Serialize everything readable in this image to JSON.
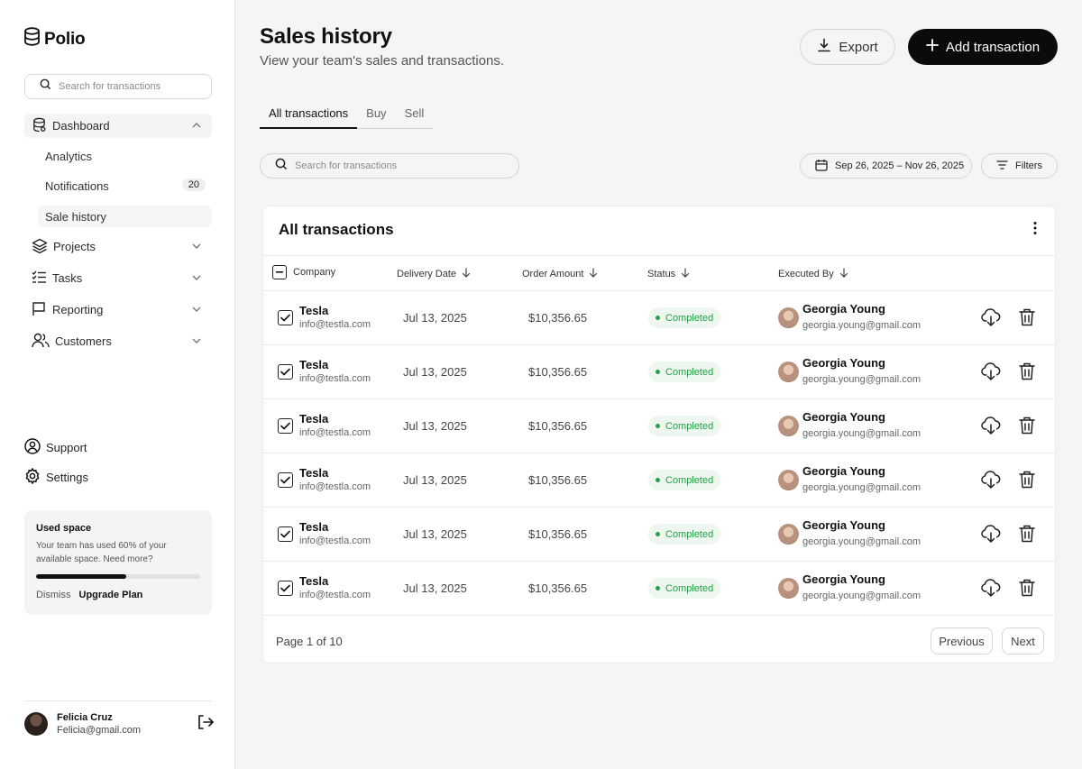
{
  "brand": {
    "name": "Polio"
  },
  "sidebar": {
    "search_placeholder": "Search for transactions",
    "nav": [
      {
        "label": "Dashboard",
        "icon": "database-icon"
      },
      {
        "label": "Projects",
        "icon": "layers-icon"
      },
      {
        "label": "Tasks",
        "icon": "list-checks-icon"
      },
      {
        "label": "Reporting",
        "icon": "flag-icon"
      },
      {
        "label": "Customers",
        "icon": "users-icon"
      }
    ],
    "sub": [
      {
        "label": "Analytics"
      },
      {
        "label": "Notifications",
        "badge": "20"
      },
      {
        "label": "Sale history"
      }
    ],
    "support": "Support",
    "settings": "Settings",
    "usage": {
      "title": "Used space",
      "text": "Your team has used 60% of your available space. Need more?",
      "percent": 0.55,
      "dismiss": "Dismiss",
      "upgrade": "Upgrade Plan"
    },
    "user": {
      "name": "Felicia Cruz",
      "email": "Felicia@gmail.com"
    }
  },
  "header": {
    "title": "Sales history",
    "subtitle": "View your team's sales and transactions.",
    "export_label": "Export",
    "add_label": "Add transaction"
  },
  "tabs": [
    "All transactions",
    "Buy",
    "Sell"
  ],
  "toolbar": {
    "search_placeholder": "Search for transactions",
    "date_range": "Sep 26, 2025 – Nov 26, 2025",
    "filters_label": "Filters"
  },
  "table": {
    "title": "All transactions",
    "columns": [
      "Company",
      "Delivery Date",
      "Order Amount",
      "Status",
      "Executed By"
    ],
    "rows": [
      {
        "company": "Tesla",
        "company_email": "info@testla.com",
        "date": "Jul 13, 2025",
        "amount": "$10,356.65",
        "status": "Completed",
        "executor": "Georgia Young",
        "executor_email": "georgia.young@gmail.com"
      },
      {
        "company": "Tesla",
        "company_email": "info@testla.com",
        "date": "Jul 13, 2025",
        "amount": "$10,356.65",
        "status": "Completed",
        "executor": "Georgia Young",
        "executor_email": "georgia.young@gmail.com"
      },
      {
        "company": "Tesla",
        "company_email": "info@testla.com",
        "date": "Jul 13, 2025",
        "amount": "$10,356.65",
        "status": "Completed",
        "executor": "Georgia Young",
        "executor_email": "georgia.young@gmail.com"
      },
      {
        "company": "Tesla",
        "company_email": "info@testla.com",
        "date": "Jul 13, 2025",
        "amount": "$10,356.65",
        "status": "Completed",
        "executor": "Georgia Young",
        "executor_email": "georgia.young@gmail.com"
      },
      {
        "company": "Tesla",
        "company_email": "info@testla.com",
        "date": "Jul 13, 2025",
        "amount": "$10,356.65",
        "status": "Completed",
        "executor": "Georgia Young",
        "executor_email": "georgia.young@gmail.com"
      },
      {
        "company": "Tesla",
        "company_email": "info@testla.com",
        "date": "Jul 13, 2025",
        "amount": "$10,356.65",
        "status": "Completed",
        "executor": "Georgia Young",
        "executor_email": "georgia.young@gmail.com"
      }
    ],
    "pagination": {
      "text": "Page 1 of 10",
      "previous": "Previous",
      "next": "Next"
    }
  },
  "colors": {
    "accent": "#0b0b0b",
    "status_green": "#21a046",
    "status_bg": "#eef7ef"
  }
}
